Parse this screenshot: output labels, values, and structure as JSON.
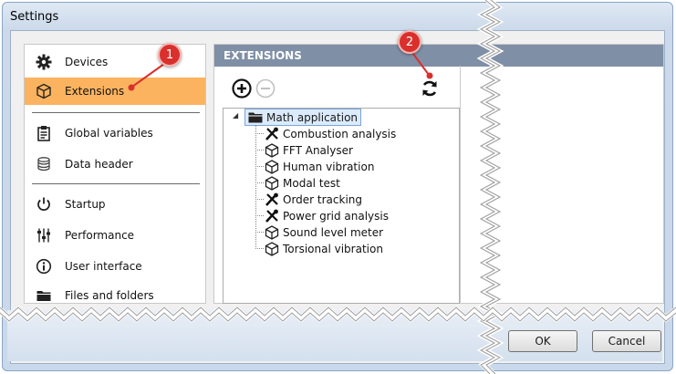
{
  "window": {
    "title": "Settings"
  },
  "sidebar": {
    "items": [
      {
        "label": "Devices",
        "icon": "gear-icon"
      },
      {
        "label": "Extensions",
        "icon": "package-icon",
        "selected": true
      },
      {
        "label": "Global variables",
        "icon": "clipboard-icon"
      },
      {
        "label": "Data header",
        "icon": "database-icon"
      },
      {
        "label": "Startup",
        "icon": "power-icon"
      },
      {
        "label": "Performance",
        "icon": "sliders-icon"
      },
      {
        "label": "User interface",
        "icon": "info-icon"
      },
      {
        "label": "Files and folders",
        "icon": "folder-icon"
      }
    ]
  },
  "extensions": {
    "header": "EXTENSIONS",
    "toolbar": {
      "add": "add-circle-icon",
      "remove": "remove-circle-icon",
      "refresh": "refresh-icon"
    },
    "tree": {
      "root": "Math application",
      "children": [
        {
          "label": "Combustion analysis",
          "icon": "tools-icon"
        },
        {
          "label": "FFT Analyser",
          "icon": "package-icon"
        },
        {
          "label": "Human vibration",
          "icon": "package-icon"
        },
        {
          "label": "Modal test",
          "icon": "package-icon"
        },
        {
          "label": "Order tracking",
          "icon": "tools-icon"
        },
        {
          "label": "Power grid analysis",
          "icon": "tools-icon"
        },
        {
          "label": "Sound level meter",
          "icon": "package-icon"
        },
        {
          "label": "Torsional vibration",
          "icon": "package-icon"
        }
      ]
    }
  },
  "buttons": {
    "ok": "OK",
    "cancel": "Cancel"
  },
  "callouts": {
    "first": "1",
    "second": "2"
  },
  "colors": {
    "selected": "#fbb35f",
    "header": "#7f8fa6",
    "callout": "#d9302d"
  }
}
